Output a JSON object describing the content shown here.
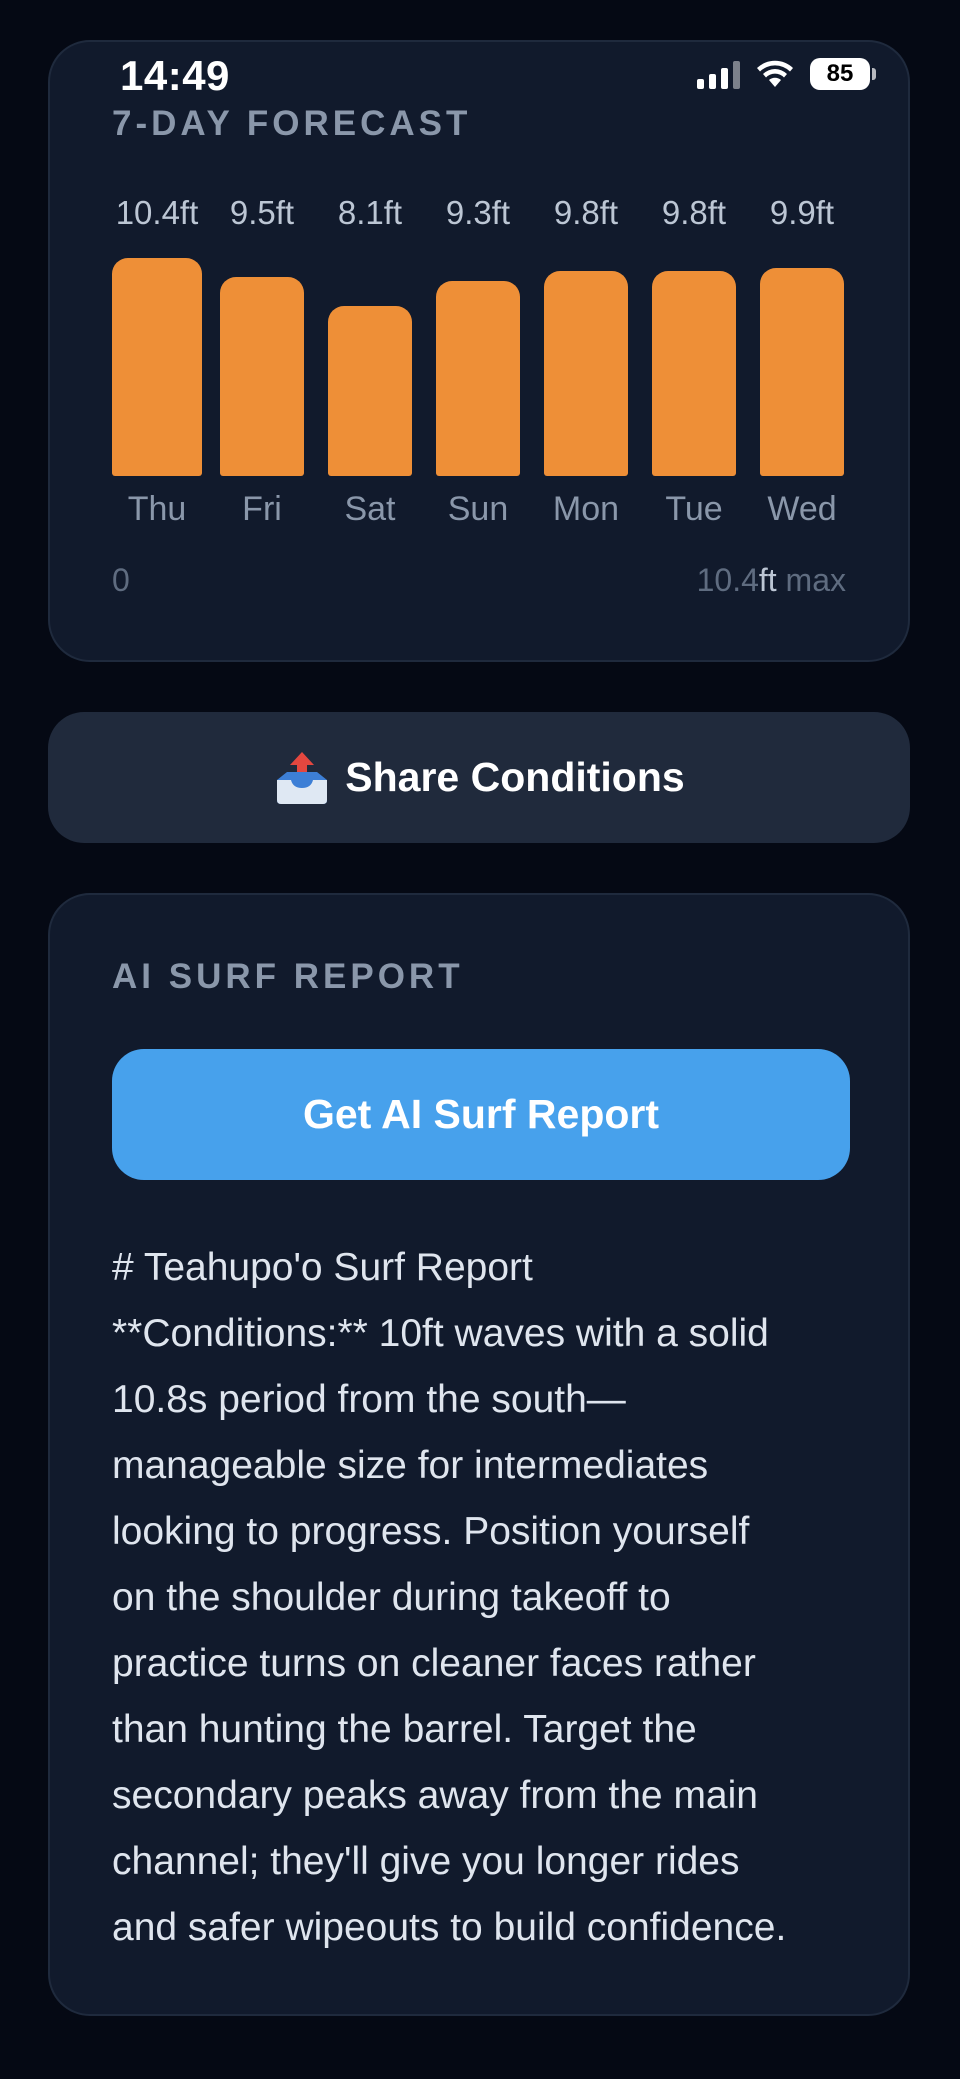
{
  "status_bar": {
    "time": "14:49",
    "battery": "85"
  },
  "forecast": {
    "title": "7-DAY FORECAST",
    "bar_color": "#ee8f37",
    "scale_min": "0",
    "scale_max_value": "10.4",
    "scale_max_unit": "ft",
    "scale_max_suffix": " max"
  },
  "chart_data": {
    "type": "bar",
    "categories": [
      "Thu",
      "Fri",
      "Sat",
      "Sun",
      "Mon",
      "Tue",
      "Wed"
    ],
    "values": [
      10.4,
      9.5,
      8.1,
      9.3,
      9.8,
      9.8,
      9.9
    ],
    "labels": [
      "10.4ft",
      "9.5ft",
      "8.1ft",
      "9.3ft",
      "9.8ft",
      "9.8ft",
      "9.9ft"
    ],
    "title": "7-DAY FORECAST",
    "ylim": [
      0,
      10.4
    ]
  },
  "share": {
    "label": "Share Conditions",
    "icon": "outbox-tray-icon"
  },
  "report": {
    "title": "AI SURF REPORT",
    "button_label": "Get AI Surf Report",
    "button_color": "#47a1ec",
    "lines": [
      "# Teahupo'o Surf Report",
      "**Conditions:** 10ft waves with a solid",
      "10.8s period from the south—",
      "manageable size for intermediates",
      "looking to progress. Position yourself",
      "on the shoulder during takeoff to",
      "practice turns on cleaner faces rather",
      "than hunting the barrel. Target the",
      "secondary peaks away from the main",
      "channel; they'll give you longer rides",
      "and safer wipeouts to build confidence."
    ]
  }
}
